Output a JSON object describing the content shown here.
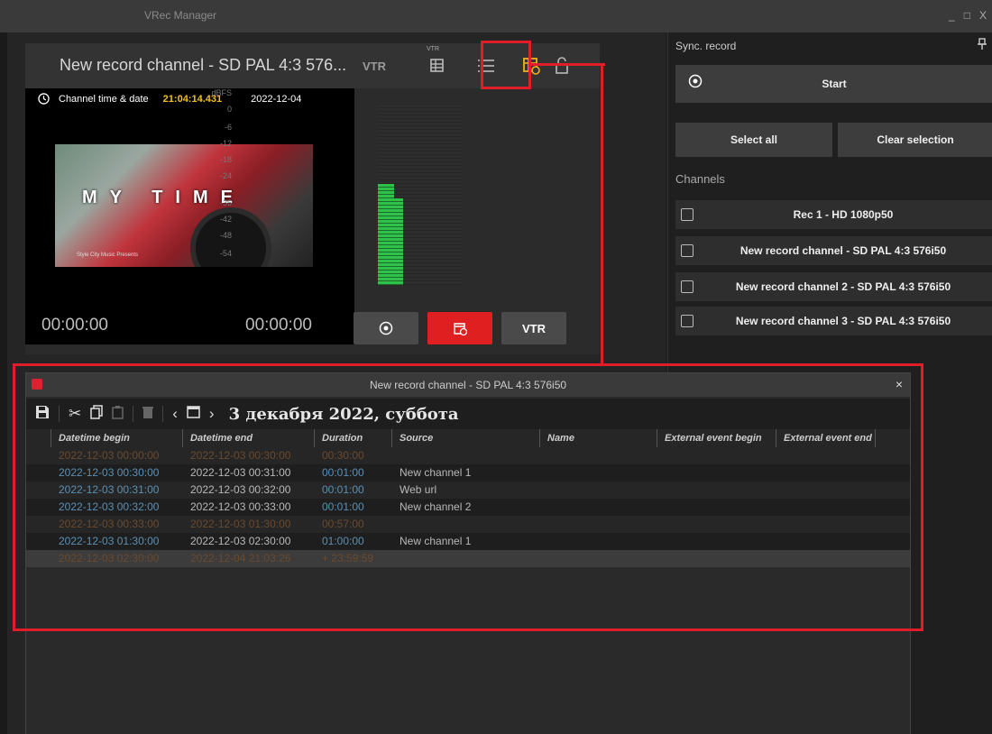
{
  "window": {
    "title": "VRec Manager",
    "controls": [
      "_",
      "□",
      "X"
    ]
  },
  "channel_card": {
    "title": "New record channel - SD PAL 4:3 576...",
    "vtr_label": "VTR",
    "vtr_small": "VTR",
    "clock_label": "Channel time & date",
    "clock_time": "21:04:14.431",
    "clock_date": "2022-12-04",
    "video_overlay": "MY TIME",
    "video_credit": "Style City Music Presents",
    "meter_unit": "dBFS",
    "meter_scale": [
      "0",
      "-6",
      "-12",
      "-18",
      "-24",
      "-36",
      "-42",
      "-48",
      "-54"
    ],
    "meter_levels": [
      0.56,
      0.48
    ],
    "timecode_left": "00:00:00",
    "timecode_right": "00:00:00",
    "footer_vtr": "VTR"
  },
  "sync_panel": {
    "title": "Sync. record",
    "start_label": "Start",
    "select_all": "Select all",
    "clear_selection": "Clear selection",
    "channels_label": "Channels",
    "channels": [
      "Rec 1 - HD 1080p50",
      "New record channel - SD PAL 4:3 576i50",
      "New record channel 2 - SD PAL 4:3 576i50",
      "New record channel 3 - SD PAL 4:3 576i50"
    ]
  },
  "schedule": {
    "title": "New record channel - SD PAL 4:3 576i50",
    "close": "×",
    "date_label": "3 декабря 2022, суббота",
    "columns": [
      "Datetime begin",
      "Datetime end",
      "Duration",
      "Source",
      "Name",
      "External event begin",
      "External event end"
    ],
    "rows": [
      {
        "begin": "2022-12-03 00:00:00",
        "end": "2022-12-03 00:30:00",
        "duration": "00:30:00",
        "source": "",
        "name": "",
        "style": "gap"
      },
      {
        "begin": "2022-12-03 00:30:00",
        "end": "2022-12-03 00:31:00",
        "duration": "00:01:00",
        "source": "New channel 1",
        "name": "",
        "style": "event"
      },
      {
        "begin": "2022-12-03 00:31:00",
        "end": "2022-12-03 00:32:00",
        "duration": "00:01:00",
        "source": "Web url",
        "name": "",
        "style": "event"
      },
      {
        "begin": "2022-12-03 00:32:00",
        "end": "2022-12-03 00:33:00",
        "duration": "00:01:00",
        "source": "New channel 2",
        "name": "",
        "style": "event"
      },
      {
        "begin": "2022-12-03 00:33:00",
        "end": "2022-12-03 01:30:00",
        "duration": "00:57:00",
        "source": "",
        "name": "",
        "style": "gap"
      },
      {
        "begin": "2022-12-03 01:30:00",
        "end": "2022-12-03 02:30:00",
        "duration": "01:00:00",
        "source": "New channel 1",
        "name": "",
        "style": "event"
      },
      {
        "begin": "2022-12-03 02:30:00",
        "end": "2022-12-04 21:03:26",
        "duration": "+ 23:59:59",
        "source": "",
        "name": "",
        "style": "selected"
      }
    ]
  },
  "colors": {
    "gap_text": "#6b4a2e",
    "event_begin": "#5b8fb3",
    "event_end": "#b8b8b8",
    "highlight": "#e01e2a",
    "accent_yellow": "#f2b01e",
    "record_red": "#e02020"
  }
}
